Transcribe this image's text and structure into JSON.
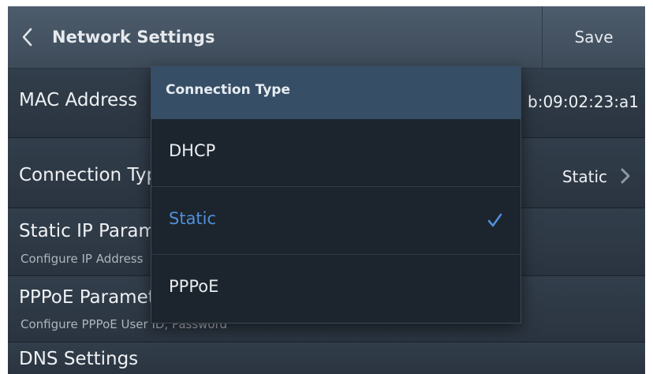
{
  "header": {
    "title": "Network Settings",
    "save_label": "Save"
  },
  "rows": {
    "mac": {
      "title": "MAC Address",
      "value": "b:09:02:23:a1"
    },
    "connection": {
      "title": "Connection Type",
      "value": "Static"
    },
    "static_ip": {
      "title": "Static IP Parameters",
      "subtitle": "Configure IP Address"
    },
    "pppoe": {
      "title": "PPPoE Parameters",
      "subtitle": "Configure PPPoE User ID, Password"
    },
    "dns": {
      "title": "DNS Settings"
    }
  },
  "dropdown": {
    "title": "Connection Type",
    "options": [
      {
        "label": "DHCP",
        "selected": false
      },
      {
        "label": "Static",
        "selected": true
      },
      {
        "label": "PPPoE",
        "selected": false
      }
    ]
  },
  "colors": {
    "accent": "#4f8fd8",
    "header_bg": "#44525f",
    "dropdown_header": "#364e66",
    "screen_bg": "#1e2731"
  },
  "icons": {
    "back": "chevron-left-icon",
    "row_arrow": "chevron-right-icon",
    "selected": "check-icon"
  }
}
